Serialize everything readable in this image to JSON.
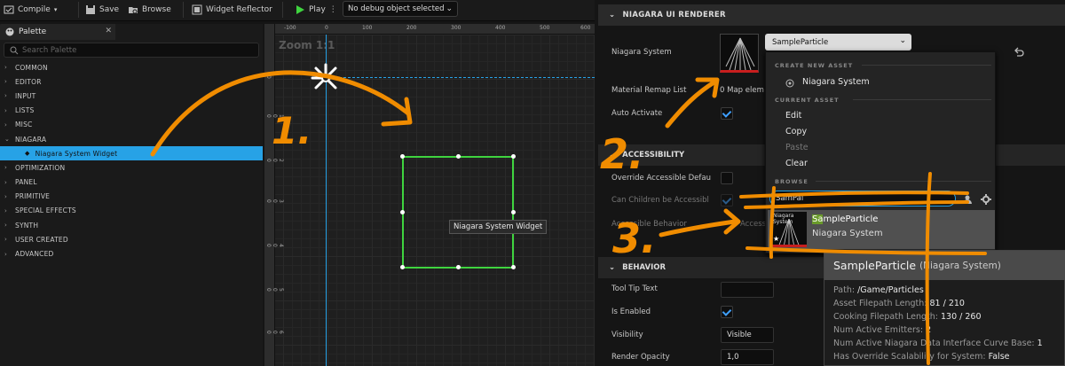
{
  "toolbar": {
    "compile": "Compile",
    "save": "Save",
    "browse": "Browse",
    "widget_reflector": "Widget Reflector",
    "play": "Play",
    "debug_object": "No debug object selected"
  },
  "palette": {
    "tab": "Palette",
    "search_placeholder": "Search Palette",
    "categories": [
      "COMMON",
      "EDITOR",
      "INPUT",
      "LISTS",
      "MISC",
      "NIAGARA",
      "OPTIMIZATION",
      "PANEL",
      "PRIMITIVE",
      "SPECIAL EFFECTS",
      "SYNTH",
      "USER CREATED",
      "ADVANCED"
    ],
    "selected_item": "Niagara System Widget"
  },
  "canvas": {
    "zoom": "Zoom 1:1",
    "ruler_top": [
      "-100",
      "0",
      "100",
      "200",
      "300",
      "400",
      "500",
      "600"
    ],
    "ruler_left": [
      "0",
      "1\n0\n0",
      "2\n0\n0",
      "3\n0\n0",
      "4\n0\n0",
      "5\n0\n0",
      "6\n0\n0"
    ],
    "widget_label": "Niagara System Widget"
  },
  "details": {
    "header": "NIAGARA UI RENDERER",
    "niagara_system_label": "Niagara System",
    "asset_value": "SampleParticle",
    "material_remap_label": "Material Remap List",
    "material_remap_value": "0 Map elem",
    "auto_activate_label": "Auto Activate",
    "accessibility_header": "ACCESSIBILITY",
    "override_accessible_label": "Override Accessible Defau",
    "can_children_label": "Can Children be Accessibl",
    "accessible_behavior_label": "Accessible Behavior",
    "accessible_behavior_value": "Accessi",
    "behavior_header": "BEHAVIOR",
    "tooltip_text_label": "Tool Tip Text",
    "is_enabled_label": "Is Enabled",
    "visibility_label": "Visibility",
    "visibility_value": "Visible",
    "render_opacity_label": "Render Opacity",
    "render_opacity_value": "1,0"
  },
  "popup": {
    "create_new_header": "CREATE NEW ASSET",
    "new_niagara_system": "Niagara System",
    "current_asset_header": "CURRENT ASSET",
    "edit": "Edit",
    "copy": "Copy",
    "paste": "Paste",
    "clear": "Clear",
    "browse_header": "BROWSE",
    "search_value": "SamPai",
    "result_name_highlight": "Sa",
    "result_name_rest": "mpleParticle",
    "result_type": "Niagara System",
    "thumb_text": "Niagara System"
  },
  "tooltip": {
    "title": "SampleParticle",
    "subtitle": "(Niagara System)",
    "rows": [
      {
        "label": "Path: ",
        "value": "/Game/Particles"
      },
      {
        "label": "Asset Filepath Length: ",
        "value": "81 / 210"
      },
      {
        "label": "Cooking Filepath Length: ",
        "value": "130 / 260"
      },
      {
        "label": "Num Active Emitters: ",
        "value": "2"
      },
      {
        "label": "Num Active Niagara Data Interface Curve Base: ",
        "value": "1"
      },
      {
        "label": "Has Override Scalability for System: ",
        "value": "False"
      }
    ]
  },
  "annotations": [
    "1.",
    "2.",
    "3."
  ],
  "colors": {
    "accent_blue": "#27a2e6",
    "annotation_orange": "#f08c00",
    "selection_green": "#3fd43f"
  }
}
